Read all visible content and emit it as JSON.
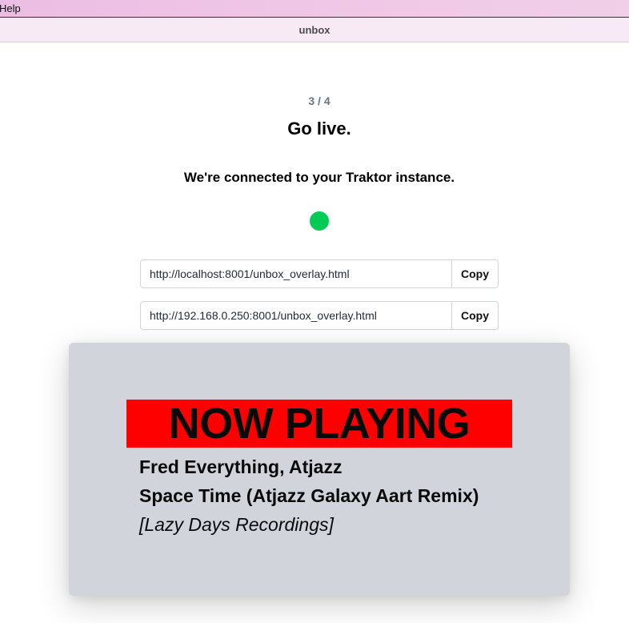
{
  "menubar": {
    "help_label": "Help"
  },
  "window": {
    "title": "unbox"
  },
  "wizard": {
    "step": "3 / 4",
    "heading": "Go live.",
    "status_message": "We're connected to your Traktor instance.",
    "status_color": "#00cc55"
  },
  "urls": [
    {
      "value": "http://localhost:8001/unbox_overlay.html",
      "copy_label": "Copy"
    },
    {
      "value": "http://192.168.0.250:8001/unbox_overlay.html",
      "copy_label": "Copy"
    }
  ],
  "overlay": {
    "banner": "NOW PLAYING",
    "banner_color": "#ff0000",
    "artist": "Fred Everything, Atjazz",
    "title": "Space Time (Atjazz Galaxy Aart Remix)",
    "label": "[Lazy Days Recordings]"
  }
}
